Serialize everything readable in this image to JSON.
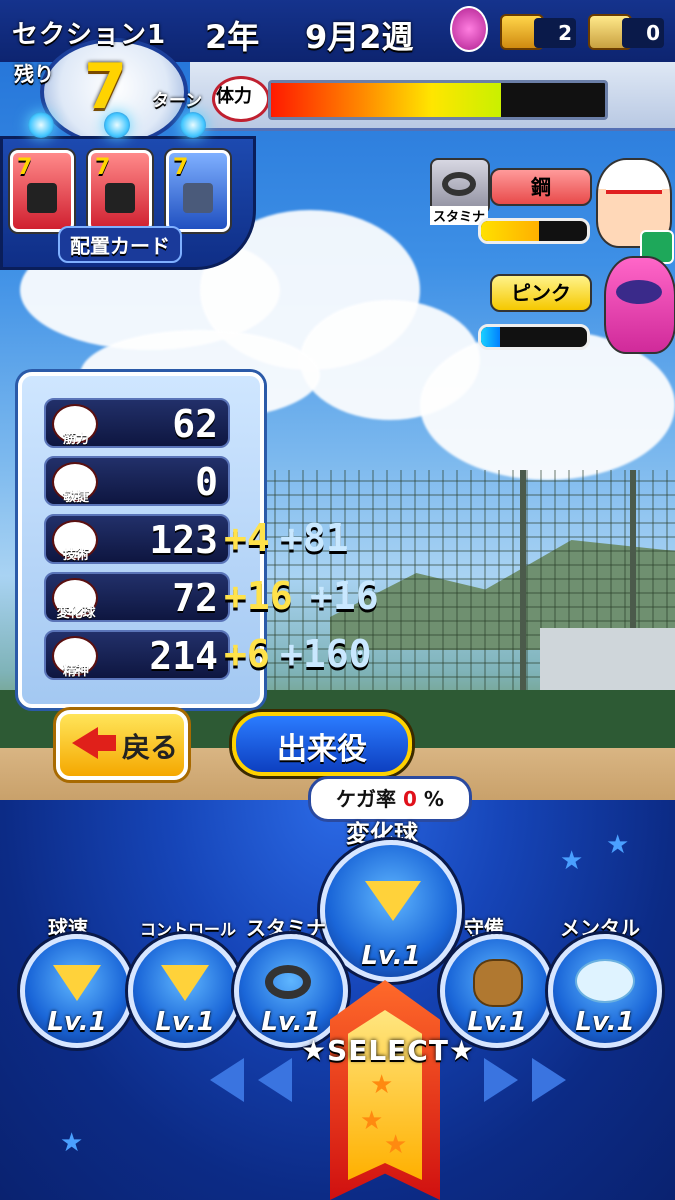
{
  "hud": {
    "section": "セクション1",
    "remaining_label": "残り",
    "remaining_turns": "7",
    "turn_label": "ターン",
    "year": "2年",
    "week": "9月2週",
    "chest1_count": "2",
    "chest2_count": "0",
    "stamina_label": "体力",
    "stamina_level": 0.69
  },
  "cards": {
    "values": [
      "7",
      "7",
      "7"
    ],
    "label": "配置カード"
  },
  "partners": [
    {
      "icon": "tire-icon",
      "tag": "スタミナ",
      "name": "鋼",
      "gauge": 0.55
    },
    {
      "name": "ピンク",
      "gauge": 0.18
    }
  ],
  "stats": [
    {
      "icon": "dumbbell-icon",
      "label": "筋力",
      "value": "62",
      "bonus1": "",
      "bonus2": ""
    },
    {
      "icon": "shoe-icon",
      "label": "敏捷",
      "value": "0",
      "bonus1": "",
      "bonus2": ""
    },
    {
      "icon": "bat-icon",
      "label": "技術",
      "value": "123",
      "bonus1": "+4",
      "bonus2": "+81"
    },
    {
      "icon": "baseball-icon",
      "label": "変化球",
      "value": "72",
      "bonus1": "+16",
      "bonus2": "+16"
    },
    {
      "icon": "spirit-icon",
      "label": "精神",
      "value": "214",
      "bonus1": "+6",
      "bonus2": "+160"
    }
  ],
  "buttons": {
    "back": "戻る",
    "dekiyaku": "出来役"
  },
  "injury": {
    "label": "ケガ率",
    "value": "0",
    "unit": "%"
  },
  "practice": {
    "selected": {
      "label": "変化球",
      "level": "Lv.1"
    },
    "options": [
      {
        "label": "球速",
        "level": "Lv.1"
      },
      {
        "label": "コントロール",
        "level": "Lv.1"
      },
      {
        "label": "スタミナ",
        "level": "Lv.1"
      },
      {
        "label": "守備",
        "level": "Lv.1"
      },
      {
        "label": "メンタル",
        "level": "Lv.1"
      }
    ],
    "select_label": "★SELECT★"
  }
}
